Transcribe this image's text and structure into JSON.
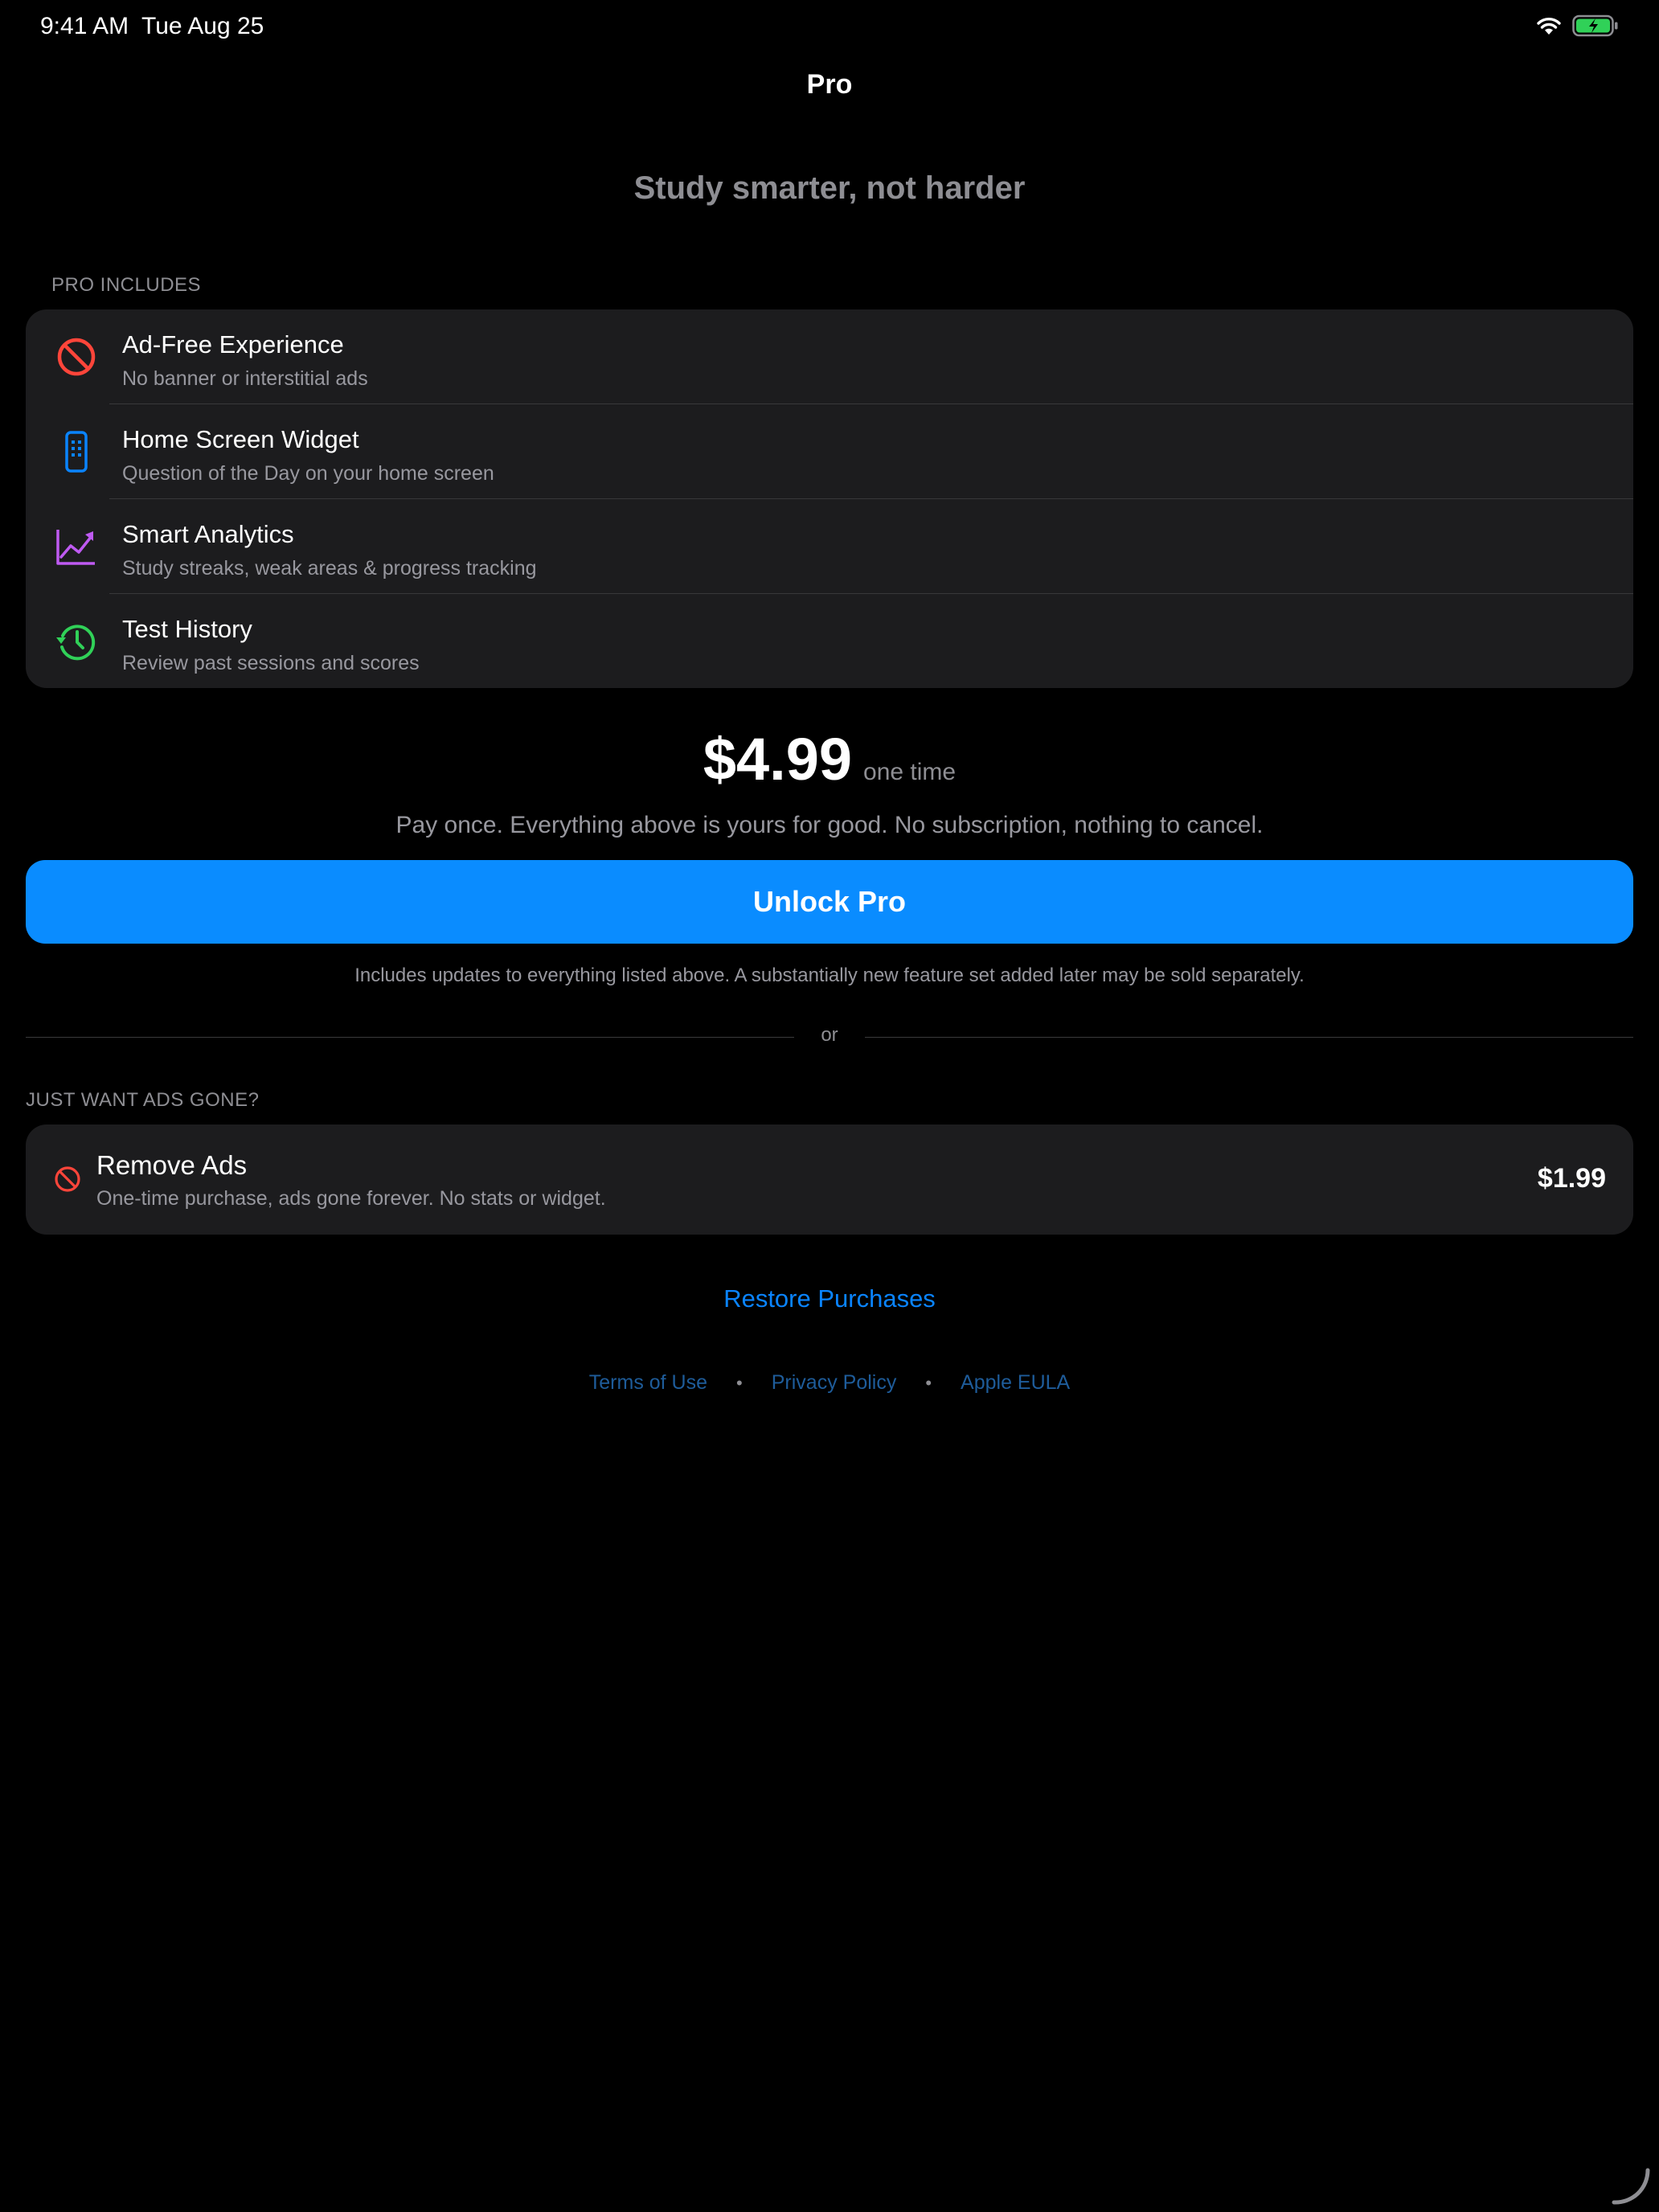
{
  "status_bar": {
    "time": "9:41 AM",
    "date": "Tue Aug 25",
    "wifi_icon": "wifi-icon",
    "battery_icon": "battery-charging-icon"
  },
  "nav": {
    "title": "Pro"
  },
  "tagline": "Study smarter, not harder",
  "pro_includes": {
    "header": "PRO INCLUDES",
    "features": [
      {
        "icon": "no-ads-icon",
        "color": "#ff453a",
        "title": "Ad-Free Experience",
        "subtitle": "No banner or interstitial ads"
      },
      {
        "icon": "phone-widget-icon",
        "color": "#0a84ff",
        "title": "Home Screen Widget",
        "subtitle": "Question of the Day on your home screen"
      },
      {
        "icon": "chart-line-icon",
        "color": "#bf5af2",
        "title": "Smart Analytics",
        "subtitle": "Study streaks, weak areas & progress tracking"
      },
      {
        "icon": "history-icon",
        "color": "#30d158",
        "title": "Test History",
        "subtitle": "Review past sessions and scores"
      }
    ]
  },
  "pricing": {
    "amount": "$4.99",
    "period": "one time",
    "description": "Pay once. Everything above is yours for good. No subscription, nothing to cancel.",
    "button_label": "Unlock Pro",
    "note": "Includes updates to everything listed above. A substantially new feature set added later may be sold separately."
  },
  "divider_text": "or",
  "remove_ads": {
    "header": "JUST WANT ADS GONE?",
    "icon": "no-ads-icon",
    "title": "Remove Ads",
    "subtitle": "One-time purchase, ads gone forever. No stats or widget.",
    "price": "$1.99"
  },
  "restore_label": "Restore Purchases",
  "legal": {
    "terms": "Terms of Use",
    "privacy": "Privacy Policy",
    "eula": "Apple EULA",
    "separator": "•"
  },
  "colors": {
    "accent": "#0a84ff",
    "button": "#0a8cff",
    "card": "#1c1c1e",
    "background": "#000000",
    "battery": "#30d158"
  }
}
